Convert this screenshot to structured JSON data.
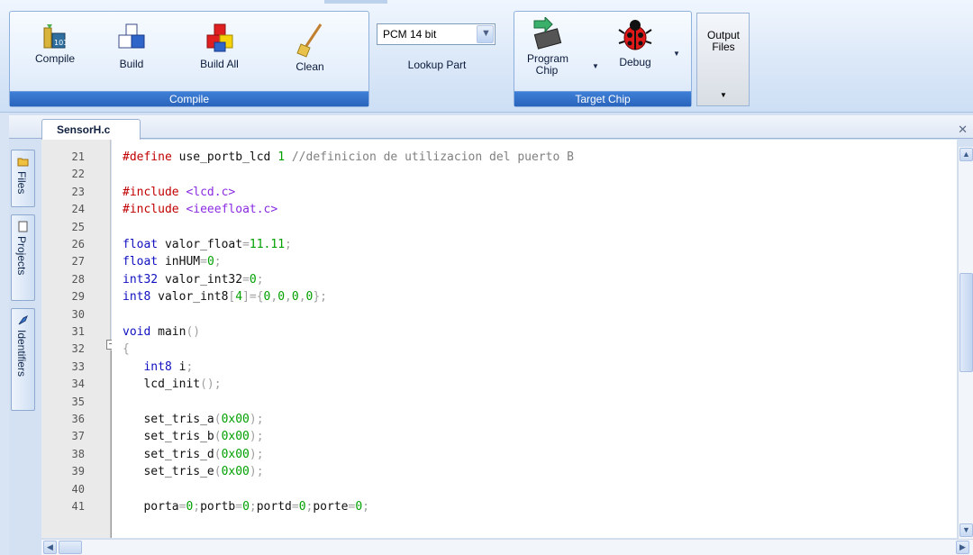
{
  "ribbon": {
    "compile_group": {
      "label": "Compile",
      "buttons": [
        {
          "label": "Compile",
          "icon": "compile-icon"
        },
        {
          "label": "Build",
          "icon": "build-icon"
        },
        {
          "label": "Build All",
          "icon": "build-all-icon"
        },
        {
          "label": "Clean",
          "icon": "clean-icon"
        }
      ]
    },
    "lookup_group": {
      "device_select": "PCM 14 bit",
      "lookup_label": "Lookup Part"
    },
    "target_group": {
      "label": "Target Chip",
      "program_chip_label": "Program Chip",
      "debug_label": "Debug"
    },
    "output_files_label": "Output Files"
  },
  "editor": {
    "tab_label": "SensorH.c",
    "side_tabs": [
      "Files",
      "Projects",
      "Identifiers"
    ],
    "lines": [
      {
        "n": "21",
        "text": "#define use_portb_lcd 1 //definicion de utilizacion del puerto B"
      },
      {
        "n": "22",
        "text": ""
      },
      {
        "n": "23",
        "text": "#include <lcd.c>"
      },
      {
        "n": "24",
        "text": "#include <ieeefloat.c>"
      },
      {
        "n": "25",
        "text": ""
      },
      {
        "n": "26",
        "text": "float valor_float=11.11;"
      },
      {
        "n": "27",
        "text": "float inHUM=0;"
      },
      {
        "n": "28",
        "text": "int32 valor_int32=0;"
      },
      {
        "n": "29",
        "text": "int8 valor_int8[4]={0,0,0,0};"
      },
      {
        "n": "30",
        "text": ""
      },
      {
        "n": "31",
        "text": "void main()"
      },
      {
        "n": "32",
        "text": "{"
      },
      {
        "n": "33",
        "text": "   int8 i;"
      },
      {
        "n": "34",
        "text": "   lcd_init();"
      },
      {
        "n": "35",
        "text": ""
      },
      {
        "n": "36",
        "text": "   set_tris_a(0x00);"
      },
      {
        "n": "37",
        "text": "   set_tris_b(0x00);"
      },
      {
        "n": "38",
        "text": "   set_tris_d(0x00);"
      },
      {
        "n": "39",
        "text": "   set_tris_e(0x00);"
      },
      {
        "n": "40",
        "text": ""
      },
      {
        "n": "41",
        "text": "   porta=0;portb=0;portd=0;porte=0;"
      }
    ]
  }
}
